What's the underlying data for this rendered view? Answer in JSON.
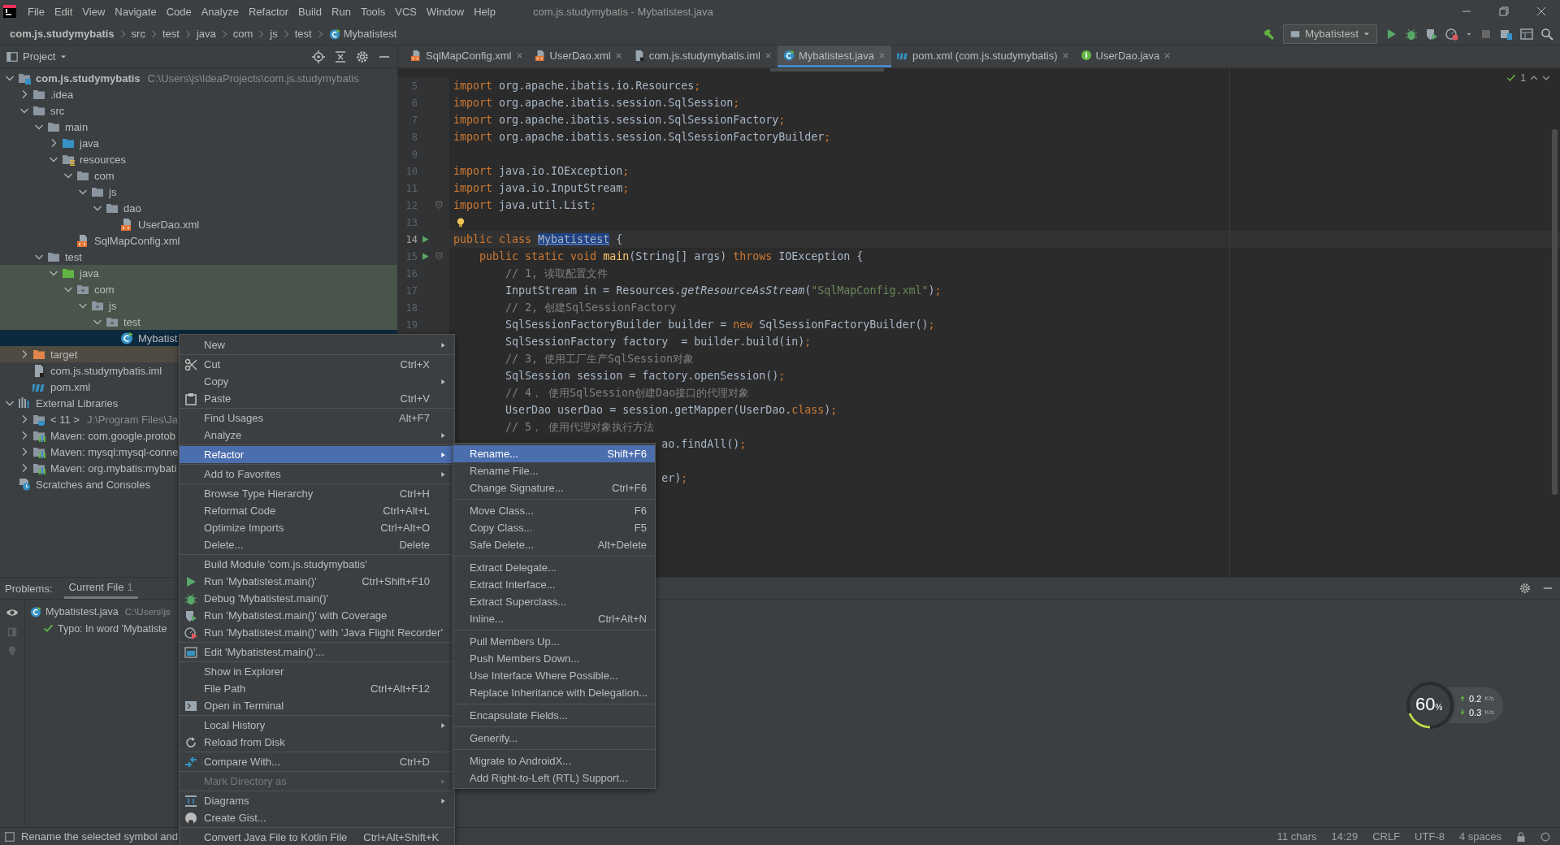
{
  "menubar": {
    "items": [
      "File",
      "Edit",
      "View",
      "Navigate",
      "Code",
      "Analyze",
      "Refactor",
      "Build",
      "Run",
      "Tools",
      "VCS",
      "Window",
      "Help"
    ],
    "title": "com.js.studymybatis - Mybatistest.java"
  },
  "navbar": {
    "crumbs": [
      "com.js.studymybatis",
      "src",
      "test",
      "java",
      "com",
      "js",
      "test",
      "Mybatistest"
    ],
    "run_config": "Mybatistest"
  },
  "project": {
    "title": "Project",
    "tree": [
      {
        "name": "com.js.studymybatis",
        "path": "C:\\Users\\js\\IdeaProjects\\com.js.studymybatis",
        "kind": "module",
        "expanded": true,
        "selected": false,
        "children": [
          {
            "name": ".idea",
            "kind": "folder",
            "expanded": false,
            "selected": false
          },
          {
            "name": "src",
            "kind": "folder",
            "expanded": true,
            "selected": false,
            "children": [
              {
                "name": "main",
                "kind": "folder",
                "expanded": true,
                "selected": false,
                "children": [
                  {
                    "name": "java",
                    "kind": "source-folder",
                    "expanded": false,
                    "selected": false
                  },
                  {
                    "name": "resources",
                    "kind": "resources",
                    "expanded": true,
                    "selected": false,
                    "children": [
                      {
                        "name": "com",
                        "kind": "folder",
                        "expanded": true,
                        "selected": false,
                        "children": [
                          {
                            "name": "js",
                            "kind": "folder",
                            "expanded": true,
                            "selected": false,
                            "children": [
                              {
                                "name": "dao",
                                "kind": "folder",
                                "expanded": true,
                                "selected": false,
                                "children": [
                                  {
                                    "name": "UserDao.xml",
                                    "kind": "xml",
                                    "selected": false
                                  }
                                ]
                              }
                            ]
                          }
                        ]
                      },
                      {
                        "name": "SqlMapConfig.xml",
                        "kind": "xml",
                        "selected": false
                      }
                    ]
                  }
                ]
              },
              {
                "name": "test",
                "kind": "folder",
                "expanded": true,
                "selected": false,
                "children": [
                  {
                    "name": "java",
                    "kind": "test-folder",
                    "color": "#49544a",
                    "expanded": true,
                    "selected": false,
                    "children": [
                      {
                        "name": "com",
                        "kind": "package",
                        "color": "#49544a",
                        "expanded": true,
                        "selected": false,
                        "children": [
                          {
                            "name": "js",
                            "kind": "package",
                            "color": "#49544a",
                            "expanded": true,
                            "selected": false,
                            "children": [
                              {
                                "name": "test",
                                "kind": "package",
                                "color": "#49544a",
                                "expanded": true,
                                "selected": false,
                                "children": [
                                  {
                                    "name": "Mybatist",
                                    "kind": "class",
                                    "selected": true
                                  }
                                ]
                              }
                            ]
                          }
                        ]
                      }
                    ]
                  }
                ]
              }
            ]
          },
          {
            "name": "target",
            "kind": "excluded",
            "color": "#4e4b43",
            "expanded": false,
            "selected": false
          },
          {
            "name": "com.js.studymybatis.iml",
            "kind": "iml",
            "selected": false
          },
          {
            "name": "pom.xml",
            "kind": "maven",
            "selected": false
          }
        ]
      },
      {
        "name": "External Libraries",
        "kind": "libraries",
        "expanded": true,
        "selected": false,
        "children": [
          {
            "name": "< 11 >",
            "path": "J:\\Program Files\\Ja",
            "kind": "jdk",
            "expanded": false,
            "selected": false
          },
          {
            "name": "Maven: com.google.protob",
            "kind": "library",
            "expanded": false,
            "selected": false
          },
          {
            "name": "Maven: mysql:mysql-conne",
            "kind": "library",
            "expanded": false,
            "selected": false
          },
          {
            "name": "Maven: org.mybatis:mybati",
            "kind": "library",
            "expanded": false,
            "selected": false
          }
        ]
      },
      {
        "name": "Scratches and Consoles",
        "kind": "scratches",
        "selected": false
      }
    ]
  },
  "editor": {
    "tabs": [
      {
        "label": "SqlMapConfig.xml",
        "kind": "xml",
        "selected": false
      },
      {
        "label": "UserDao.xml",
        "kind": "xml",
        "selected": false
      },
      {
        "label": "com.js.studymybatis.iml",
        "kind": "iml",
        "selected": false
      },
      {
        "label": "Mybatistest.java",
        "kind": "class",
        "selected": true
      },
      {
        "label": "pom.xml (com.js.studymybatis)",
        "kind": "maven",
        "selected": false
      },
      {
        "label": "UserDao.java",
        "kind": "interface",
        "selected": false
      }
    ],
    "inspection_count": "1",
    "lines": [
      {
        "n": "5",
        "current": false,
        "tokens": [
          {
            "kind": "kw",
            "t": "import "
          },
          {
            "kind": "id",
            "t": "org.apache.ibatis.io.Resources"
          },
          {
            "kind": "kw",
            "t": ";"
          }
        ]
      },
      {
        "n": "6",
        "current": false,
        "tokens": [
          {
            "kind": "kw",
            "t": "import "
          },
          {
            "kind": "id",
            "t": "org.apache.ibatis.session.SqlSession"
          },
          {
            "kind": "kw",
            "t": ";"
          }
        ]
      },
      {
        "n": "7",
        "current": false,
        "tokens": [
          {
            "kind": "kw",
            "t": "import "
          },
          {
            "kind": "id",
            "t": "org.apache.ibatis.session.SqlSessionFactory"
          },
          {
            "kind": "kw",
            "t": ";"
          }
        ]
      },
      {
        "n": "8",
        "current": false,
        "tokens": [
          {
            "kind": "kw",
            "t": "import "
          },
          {
            "kind": "id",
            "t": "org.apache.ibatis.session.SqlSessionFactoryBuilder"
          },
          {
            "kind": "kw",
            "t": ";"
          }
        ]
      },
      {
        "n": "9",
        "current": false
      },
      {
        "n": "10",
        "current": false,
        "tokens": [
          {
            "kind": "kw",
            "t": "import "
          },
          {
            "kind": "id",
            "t": "java.io.IOException"
          },
          {
            "kind": "kw",
            "t": ";"
          }
        ]
      },
      {
        "n": "11",
        "current": false,
        "tokens": [
          {
            "kind": "kw",
            "t": "import "
          },
          {
            "kind": "id",
            "t": "java.io.InputStream"
          },
          {
            "kind": "kw",
            "t": ";"
          }
        ]
      },
      {
        "n": "12",
        "current": false,
        "kind": "fold",
        "tokens": [
          {
            "kind": "kw",
            "t": "import "
          },
          {
            "kind": "id",
            "t": "java.util.List"
          },
          {
            "kind": "kw",
            "t": ";"
          }
        ]
      },
      {
        "n": "13",
        "current": false,
        "kind": "bulb"
      },
      {
        "n": "14",
        "current": true,
        "kind": "run",
        "tokens": [
          {
            "kind": "kw",
            "t": "public class "
          },
          {
            "kind": "hl",
            "t": "Mybatistest"
          },
          {
            "kind": "id",
            "t": " {"
          }
        ]
      },
      {
        "n": "15",
        "current": false,
        "kind": "run-fold",
        "tokens": [
          {
            "kind": "kw",
            "t": "    public static void "
          },
          {
            "kind": "fn",
            "t": "main"
          },
          {
            "kind": "id",
            "t": "(String[] args) "
          },
          {
            "kind": "kw",
            "t": "throws "
          },
          {
            "kind": "id",
            "t": "IOException {"
          }
        ]
      },
      {
        "n": "16",
        "current": false,
        "tokens": [
          {
            "kind": "cmt",
            "t": "        // 1, 读取配置文件"
          }
        ]
      },
      {
        "n": "17",
        "current": false,
        "tokens": [
          {
            "kind": "id",
            "t": "        InputStream in = Resources."
          },
          {
            "kind": "st",
            "t": "getResourceAsStream"
          },
          {
            "kind": "id",
            "t": "("
          },
          {
            "kind": "str",
            "t": "\"SqlMapConfig.xml\""
          },
          {
            "kind": "id",
            "t": ")"
          },
          {
            "kind": "kw",
            "t": ";"
          }
        ]
      },
      {
        "n": "18",
        "current": false,
        "tokens": [
          {
            "kind": "cmt",
            "t": "        // 2, 创建SqlSessionFactory"
          }
        ]
      },
      {
        "n": "19",
        "current": false,
        "tokens": [
          {
            "kind": "id",
            "t": "        SqlSessionFactoryBuilder builder = "
          },
          {
            "kind": "kw",
            "t": "new "
          },
          {
            "kind": "id",
            "t": "SqlSessionFactoryBuilder()"
          },
          {
            "kind": "kw",
            "t": ";"
          }
        ]
      },
      {
        "tokens": [
          {
            "kind": "id",
            "t": "        SqlSessionFactory factory  = builder.build(in)"
          },
          {
            "kind": "kw",
            "t": ";"
          }
        ]
      },
      {
        "tokens": [
          {
            "kind": "cmt",
            "t": "        // 3, 使用工厂生产SqlSession对象"
          }
        ]
      },
      {
        "tokens": [
          {
            "kind": "id",
            "t": "        SqlSession session = factory.openSession()"
          },
          {
            "kind": "kw",
            "t": ";"
          }
        ]
      },
      {
        "tokens": [
          {
            "kind": "cmt",
            "t": "        // 4， 使用SqlSession创建Dao接口的代理对象"
          }
        ]
      },
      {
        "tokens": [
          {
            "kind": "id",
            "t": "        UserDao userDao = session.getMapper(UserDao."
          },
          {
            "kind": "kw",
            "t": "class"
          },
          {
            "kind": "id",
            "t": ")"
          },
          {
            "kind": "kw",
            "t": ";"
          }
        ]
      },
      {
        "tokens": [
          {
            "kind": "cmt",
            "t": "        // 5， 使用代理对象执行方法"
          }
        ]
      },
      {
        "tokens": [
          {
            "kind": "id",
            "t": "                                ao.findAll()"
          },
          {
            "kind": "kw",
            "t": ";"
          }
        ]
      },
      {
        "kind": "after-gap",
        "tokens": [
          {
            "kind": "id",
            "t": "                                er)"
          },
          {
            "kind": "kw",
            "t": ";"
          }
        ]
      }
    ]
  },
  "context_menu": {
    "groups": [
      {
        "items": [
          {
            "label": "New",
            "kind": "plain",
            "submenu": true,
            "selected": false,
            "disabled": false
          }
        ]
      },
      {
        "items": [
          {
            "label": "Cut",
            "shortcut": "Ctrl+X",
            "kind": "cut",
            "submenu": false,
            "selected": false,
            "disabled": false
          },
          {
            "label": "Copy",
            "kind": "plain",
            "submenu": true,
            "selected": false,
            "disabled": false
          },
          {
            "label": "Paste",
            "shortcut": "Ctrl+V",
            "kind": "paste",
            "submenu": false,
            "selected": false,
            "disabled": false
          }
        ]
      },
      {
        "items": [
          {
            "label": "Find Usages",
            "shortcut": "Alt+F7",
            "kind": "plain",
            "submenu": false,
            "selected": false,
            "disabled": false
          },
          {
            "label": "Analyze",
            "kind": "plain",
            "submenu": true,
            "selected": false,
            "disabled": false
          }
        ]
      },
      {
        "items": [
          {
            "label": "Refactor",
            "kind": "plain",
            "submenu": true,
            "selected": true,
            "disabled": false
          }
        ]
      },
      {
        "items": [
          {
            "label": "Add to Favorites",
            "kind": "plain",
            "submenu": true,
            "selected": false,
            "disabled": false
          }
        ]
      },
      {
        "items": [
          {
            "label": "Browse Type Hierarchy",
            "shortcut": "Ctrl+H",
            "kind": "plain",
            "submenu": false,
            "selected": false,
            "disabled": false
          },
          {
            "label": "Reformat Code",
            "shortcut": "Ctrl+Alt+L",
            "kind": "plain",
            "submenu": false,
            "selected": false,
            "disabled": false
          },
          {
            "label": "Optimize Imports",
            "shortcut": "Ctrl+Alt+O",
            "kind": "plain",
            "submenu": false,
            "selected": false,
            "disabled": false
          },
          {
            "label": "Delete...",
            "shortcut": "Delete",
            "kind": "plain",
            "submenu": false,
            "selected": false,
            "disabled": false
          }
        ]
      },
      {
        "items": [
          {
            "label": "Build Module 'com.js.studymybatis'",
            "kind": "plain",
            "submenu": false,
            "selected": false,
            "disabled": false
          },
          {
            "label": "Run 'Mybatistest.main()'",
            "shortcut": "Ctrl+Shift+F10",
            "kind": "run",
            "submenu": false,
            "selected": false,
            "disabled": false
          },
          {
            "label": "Debug 'Mybatistest.main()'",
            "kind": "debug",
            "submenu": false,
            "selected": false,
            "disabled": false
          },
          {
            "label": "Run 'Mybatistest.main()' with Coverage",
            "kind": "coverage",
            "submenu": false,
            "selected": false,
            "disabled": false
          },
          {
            "label": "Run 'Mybatistest.main()' with 'Java Flight Recorder'",
            "kind": "profiler",
            "submenu": false,
            "selected": false,
            "disabled": false
          }
        ]
      },
      {
        "items": [
          {
            "label": "Edit 'Mybatistest.main()'...",
            "kind": "edit",
            "submenu": false,
            "selected": false,
            "disabled": false
          }
        ]
      },
      {
        "items": [
          {
            "label": "Show in Explorer",
            "kind": "plain",
            "submenu": false,
            "selected": false,
            "disabled": false
          },
          {
            "label": "File Path",
            "shortcut": "Ctrl+Alt+F12",
            "kind": "plain",
            "submenu": false,
            "selected": false,
            "disabled": false
          },
          {
            "label": "Open in Terminal",
            "kind": "terminal",
            "submenu": false,
            "selected": false,
            "disabled": false
          }
        ]
      },
      {
        "items": [
          {
            "label": "Local History",
            "kind": "plain",
            "submenu": true,
            "selected": false,
            "disabled": false
          },
          {
            "label": "Reload from Disk",
            "kind": "reload",
            "submenu": false,
            "selected": false,
            "disabled": false
          }
        ]
      },
      {
        "items": [
          {
            "label": "Compare With...",
            "shortcut": "Ctrl+D",
            "kind": "compare",
            "submenu": false,
            "selected": false,
            "disabled": false
          }
        ]
      },
      {
        "items": [
          {
            "label": "Mark Directory as",
            "kind": "plain",
            "submenu": true,
            "selected": false,
            "disabled": true
          }
        ]
      },
      {
        "items": [
          {
            "label": "Diagrams",
            "kind": "diagrams",
            "submenu": true,
            "selected": false,
            "disabled": false
          },
          {
            "label": "Create Gist...",
            "kind": "gist",
            "submenu": false,
            "selected": false,
            "disabled": false
          }
        ]
      },
      {
        "items": [
          {
            "label": "Convert Java File to Kotlin File",
            "shortcut": "Ctrl+Alt+Shift+K",
            "kind": "plain",
            "submenu": false,
            "selected": false,
            "disabled": false
          }
        ]
      }
    ]
  },
  "refactor_submenu": {
    "groups": [
      {
        "items": [
          {
            "label": "Rename...",
            "shortcut": "Shift+F6",
            "selected": true
          },
          {
            "label": "Rename File...",
            "selected": false
          },
          {
            "label": "Change Signature...",
            "shortcut": "Ctrl+F6",
            "selected": false
          }
        ]
      },
      {
        "items": [
          {
            "label": "Move Class...",
            "shortcut": "F6",
            "selected": false
          },
          {
            "label": "Copy Class...",
            "shortcut": "F5",
            "selected": false
          },
          {
            "label": "Safe Delete...",
            "shortcut": "Alt+Delete",
            "selected": false
          }
        ]
      },
      {
        "items": [
          {
            "label": "Extract Delegate...",
            "selected": false
          },
          {
            "label": "Extract Interface...",
            "selected": false
          },
          {
            "label": "Extract Superclass...",
            "selected": false
          },
          {
            "label": "Inline...",
            "shortcut": "Ctrl+Alt+N",
            "selected": false
          }
        ]
      },
      {
        "items": [
          {
            "label": "Pull Members Up...",
            "selected": false
          },
          {
            "label": "Push Members Down...",
            "selected": false
          },
          {
            "label": "Use Interface Where Possible...",
            "selected": false
          },
          {
            "label": "Replace Inheritance with Delegation...",
            "selected": false
          }
        ]
      },
      {
        "items": [
          {
            "label": "Encapsulate Fields...",
            "selected": false
          }
        ]
      },
      {
        "items": [
          {
            "label": "Generify...",
            "selected": false
          }
        ]
      },
      {
        "items": [
          {
            "label": "Migrate to AndroidX...",
            "selected": false
          },
          {
            "label": "Add Right-to-Left (RTL) Support...",
            "selected": false
          }
        ]
      }
    ]
  },
  "problems": {
    "title": "Problems:",
    "tabs": [
      {
        "label": "Current File",
        "count": "1",
        "selected": true
      }
    ],
    "rows": [
      {
        "kind": "file",
        "label": "Mybatistest.java",
        "path": "C:\\Users\\js"
      },
      {
        "kind": "typo",
        "label": "Typo: In word 'Mybatiste"
      }
    ]
  },
  "network_meter": {
    "percent": "60",
    "unit": "%",
    "upload": "0.2",
    "upload_unit": "K/s",
    "download": "0.3",
    "download_unit": "K/s"
  },
  "status_bar": {
    "message": "Rename the selected symbol and",
    "items": [
      "11 chars",
      "14:29",
      "CRLF",
      "UTF-8",
      "4 spaces"
    ]
  }
}
